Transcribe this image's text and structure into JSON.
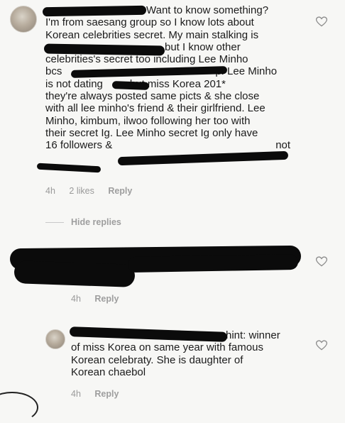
{
  "comment1": {
    "first_line_end": "Want to know something?",
    "lines": [
      "I'm from saesang group so I know lots about",
      "Korean celebrities secret. My main stalking is",
      "but I know other",
      "celebrities's secret too including Lee Minho",
      "bcs",
      "p. Lee Minho",
      "is not dating",
      "but miss Korea 201*",
      "they're always posted same picts & she close",
      "with all lee minho's friend & their girlfriend. Lee",
      "Minho, kimbum, ilwoo following her too with",
      "their secret Ig. Lee Minho secret Ig only have",
      "16 followers &",
      "not"
    ],
    "time": "4h",
    "likes": "2 likes",
    "reply": "Reply"
  },
  "hide_replies": "Hide replies",
  "reply1": {
    "time": "4h",
    "reply": "Reply"
  },
  "reply2": {
    "first_line_end": "hint: winner",
    "lines": [
      "of miss Korea on same year with famous",
      "Korean celebraty. She is daughter of",
      "Korean chaebol"
    ],
    "time": "4h",
    "reply": "Reply"
  },
  "icons": {
    "like": "heart-outline-icon",
    "avatar": "user-avatar"
  }
}
